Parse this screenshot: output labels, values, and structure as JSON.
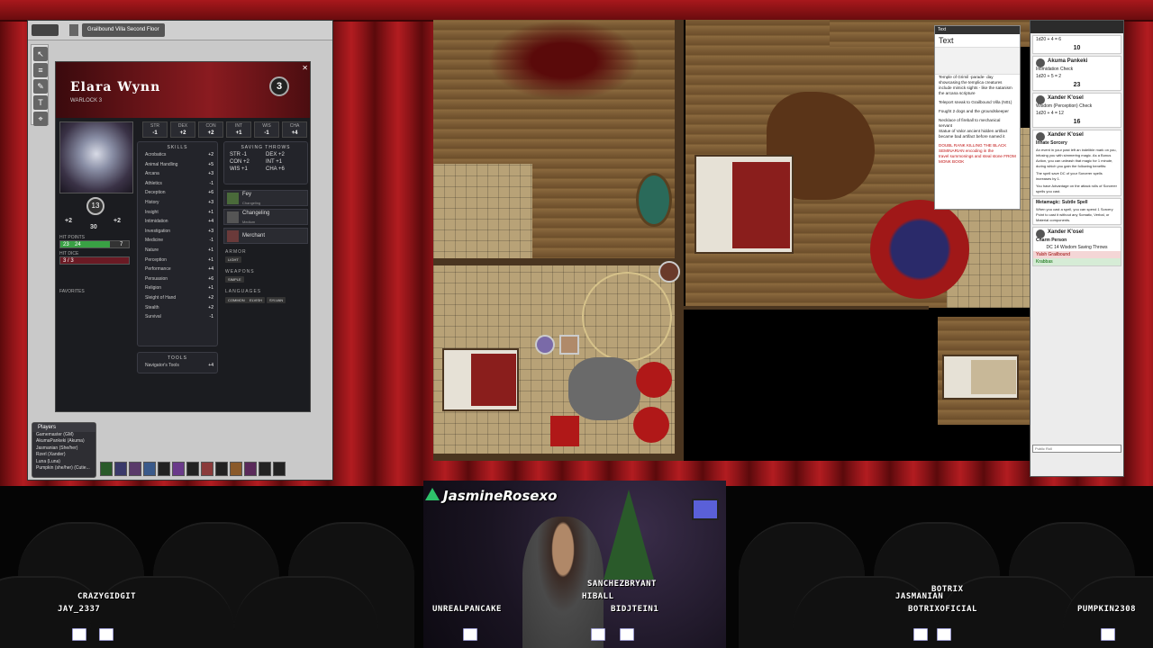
{
  "vtt": {
    "page_tab": "Grailbound Villa Second Floor",
    "sheet": {
      "name": "Elara Wynn",
      "class_level": "WARLOCK 3",
      "level": "3",
      "ac": "13",
      "initiative": "+2",
      "speed": "30",
      "proficiency": "+2",
      "hp_current": "23",
      "hp_max": "24",
      "temp_hp": "7",
      "hit_dice": "3 / 3",
      "hp_label": "HIT POINTS",
      "hd_label": "HIT DICE",
      "favorites_label": "FAVORITES",
      "abilities": [
        {
          "name": "STR",
          "mod": "-1"
        },
        {
          "name": "DEX",
          "mod": "+2"
        },
        {
          "name": "CON",
          "mod": "+2"
        },
        {
          "name": "INT",
          "mod": "+1"
        },
        {
          "name": "WIS",
          "mod": "-1"
        },
        {
          "name": "CHA",
          "mod": "+4"
        }
      ],
      "skills_title": "SKILLS",
      "skills": [
        {
          "name": "Acrobatics",
          "mod": "+2"
        },
        {
          "name": "Animal Handling",
          "mod": "+5"
        },
        {
          "name": "Arcana",
          "mod": "+3"
        },
        {
          "name": "Athletics",
          "mod": "-1"
        },
        {
          "name": "Deception",
          "mod": "+6"
        },
        {
          "name": "History",
          "mod": "+3"
        },
        {
          "name": "Insight",
          "mod": "+1"
        },
        {
          "name": "Intimidation",
          "mod": "+4"
        },
        {
          "name": "Investigation",
          "mod": "+3"
        },
        {
          "name": "Medicine",
          "mod": "-1"
        },
        {
          "name": "Nature",
          "mod": "+1"
        },
        {
          "name": "Perception",
          "mod": "+1"
        },
        {
          "name": "Performance",
          "mod": "+4"
        },
        {
          "name": "Persuasion",
          "mod": "+6"
        },
        {
          "name": "Religion",
          "mod": "+1"
        },
        {
          "name": "Sleight of Hand",
          "mod": "+2"
        },
        {
          "name": "Stealth",
          "mod": "+2"
        },
        {
          "name": "Survival",
          "mod": "-1"
        }
      ],
      "saves_title": "SAVING THROWS",
      "saves": [
        {
          "name": "STR",
          "mod": "-1"
        },
        {
          "name": "DEX",
          "mod": "+2"
        },
        {
          "name": "CON",
          "mod": "+2"
        },
        {
          "name": "INT",
          "mod": "+1"
        },
        {
          "name": "WIS",
          "mod": "+1"
        },
        {
          "name": "CHA",
          "mod": "+6"
        }
      ],
      "feats": [
        {
          "name": "Fey",
          "sub": "Changeling"
        },
        {
          "name": "Changeling",
          "sub": "Medium"
        },
        {
          "name": "Merchant",
          "sub": ""
        }
      ],
      "armor_label": "ARMOR",
      "armor": [
        "LIGHT"
      ],
      "weapons_label": "WEAPONS",
      "weapons": [
        "SIMPLE"
      ],
      "languages_label": "LANGUAGES",
      "languages": [
        "COMMON",
        "ELVISH",
        "SYLVAN"
      ],
      "tools_title": "TOOLS",
      "tools": [
        {
          "name": "Navigator's Tools",
          "mod": "+4"
        }
      ]
    },
    "players_title": "Players",
    "players": [
      "Gamemaster (GM)",
      "AkumaPankeki (Akuma)",
      "Jasmanian (She/her)",
      "Rzerl (Xander)",
      "Luna (Luna)",
      "Pumpkin (she/her) (Cutie..."
    ]
  },
  "text_dialog": {
    "title": "Text",
    "heading": "Text",
    "lines": [
      "Temple of Grimil -parade- day",
      "showcasing the templica creatures",
      "include mimick sights - like the satanism",
      "the arcana scripture",
      "",
      "Teleport sneak to Grailbound Villa (N01)",
      "",
      "Fought 2 dogs and the groundskeeper",
      "",
      "Necklace of fireball to mechanical",
      "servant",
      "Statue of Valor ancient hidden artifact",
      "became bad artifact before named it"
    ],
    "red_lines": [
      "DOUBL RANK KILLING THE BLACK",
      "SEMINARIAN encoding in the",
      "travel summonings and steal stone FROM",
      "MONK BOOK"
    ]
  },
  "chat": {
    "messages": [
      {
        "who": "",
        "value": "10",
        "lines": [
          "1d20 + 4 = 6"
        ]
      },
      {
        "who": "Akuma Pankeki",
        "value": "23",
        "lines": [
          "Intimidation Check",
          "1d20 + 5 = 2"
        ]
      },
      {
        "who": "Xander K'osel",
        "value": "16",
        "lines": [
          "Wisdom (Perception) Check",
          "1d20 + 4 = 12"
        ]
      },
      {
        "who": "Xander K'osel",
        "value": "",
        "lines": [
          "Innate Sorcery",
          "An event in your past left an indelible mark on you, infusing you with simmering magic. As a Bonus Action, you can unleash that magic for 1 minute, during which you gain the following benefits:",
          "The spell save DC of your Sorcerer spells increases by 1.",
          "You have Advantage on the attack rolls of Sorcerer spells you cast."
        ]
      },
      {
        "who": "",
        "value": "",
        "lines": [
          "Metamagic: Subtle Spell",
          "When you cast a spell, you can spend 1 Sorcery Point to cast it without any Somatic, Verbal, or Material components."
        ]
      },
      {
        "who": "Xander K'osel",
        "value": "",
        "lines": [
          "Charm Person",
          "DC 14 Wisdom Saving Throws",
          "Yalsh Grailbound",
          "Krabbas"
        ]
      }
    ],
    "input_placeholder": "Public Roll"
  },
  "stream": {
    "streamer": "JasmineRosexo",
    "viewers": [
      {
        "name": "CRAZYGIDGIT"
      },
      {
        "name": "JAY_2337"
      },
      {
        "name": "UNREALPANCAKE"
      },
      {
        "name": "SANCHEZBRYANT"
      },
      {
        "name": "HIBALL"
      },
      {
        "name": "BIDJTEIN1"
      },
      {
        "name": "BOTRIX"
      },
      {
        "name": "JASMANIAN"
      },
      {
        "name": "BOTRIXOFICIAL"
      },
      {
        "name": "PUMPKIN2308"
      }
    ]
  },
  "colors": {
    "curtain": "#b21c20",
    "sheet_bg": "#1b1c20",
    "hp_green": "#39a044",
    "map_floor": "#b8a277"
  }
}
